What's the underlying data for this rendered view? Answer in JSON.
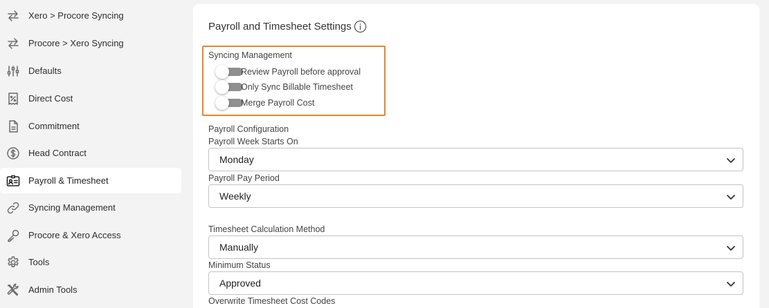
{
  "sidebar": {
    "items": [
      {
        "label": "Xero > Procore Syncing",
        "icon": "swap-arrows-icon"
      },
      {
        "label": "Procore > Xero Syncing",
        "icon": "swap-arrows-icon"
      },
      {
        "label": "Defaults",
        "icon": "sliders-icon"
      },
      {
        "label": "Direct Cost",
        "icon": "percent-receipt-icon"
      },
      {
        "label": "Commitment",
        "icon": "document-icon"
      },
      {
        "label": "Head Contract",
        "icon": "dollar-circle-icon"
      },
      {
        "label": "Payroll & Timesheet",
        "icon": "id-card-icon"
      },
      {
        "label": "Syncing Management",
        "icon": "link-icon"
      },
      {
        "label": "Procore & Xero Access",
        "icon": "key-icon"
      },
      {
        "label": "Tools",
        "icon": "gear-icon"
      },
      {
        "label": "Admin Tools",
        "icon": "wrench-screwdriver-icon"
      }
    ],
    "active_label": "Payroll & Timesheet"
  },
  "main": {
    "title": "Payroll and Timesheet Settings",
    "syncing_management": {
      "label": "Syncing Management",
      "toggles": [
        {
          "label": "Review Payroll before approval",
          "on": false
        },
        {
          "label": "Only Sync Billable Timesheet",
          "on": false
        },
        {
          "label": "Merge Payroll Cost",
          "on": false
        }
      ]
    },
    "payroll_configuration": {
      "label": "Payroll Configuration",
      "week_starts_label": "Payroll Week Starts On",
      "week_starts_value": "Monday",
      "pay_period_label": "Payroll Pay Period",
      "pay_period_value": "Weekly"
    },
    "timesheet": {
      "calc_method_label": "Timesheet Calculation Method",
      "calc_method_value": "Manually",
      "min_status_label": "Minimum Status",
      "min_status_value": "Approved",
      "overwrite_label": "Overwrite Timesheet Cost Codes"
    }
  },
  "colors": {
    "highlight": "#e8842e",
    "toggle_off": "#8f8f8f",
    "background": "#f3f3f3"
  }
}
